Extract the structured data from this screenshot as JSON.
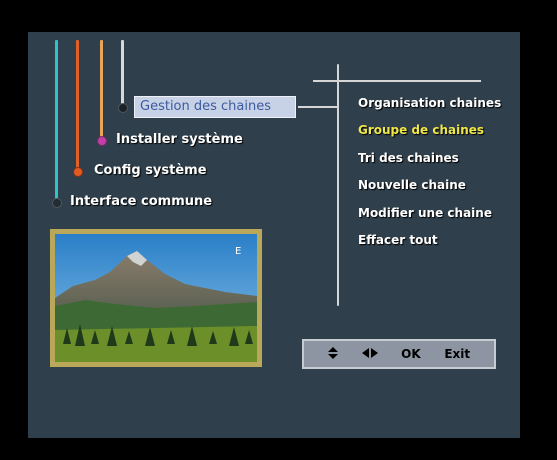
{
  "menu": {
    "items": [
      {
        "label": "Gestion des chaines",
        "selected": true,
        "bullet_color": "#1a2428"
      },
      {
        "label": "Installer système",
        "selected": false,
        "bullet_color": "#c23fa8"
      },
      {
        "label": "Config système",
        "selected": false,
        "bullet_color": "#e05a23"
      },
      {
        "label": "Interface commune",
        "selected": false,
        "bullet_color": "#1f2c34"
      }
    ]
  },
  "submenu": {
    "items": [
      {
        "label": "Organisation chaines",
        "active": false
      },
      {
        "label": "Groupe de chaines",
        "active": true
      },
      {
        "label": "Tri des chaines",
        "active": false
      },
      {
        "label": "Nouvelle chaine",
        "active": false
      },
      {
        "label": "Modifier une chaine",
        "active": false
      },
      {
        "label": "Effacer tout",
        "active": false
      }
    ]
  },
  "preview": {
    "icon": "mountain-landscape-image",
    "badge": "E"
  },
  "controls": {
    "updown_icon": "updown-arrows-icon",
    "leftright_icon": "leftright-arrows-icon",
    "ok_label": "OK",
    "exit_label": "Exit"
  },
  "colors": {
    "background": "#2f3f4b",
    "highlight": "#f0e64a",
    "line_cyan": "#2ec4c8",
    "line_orange": "#e0602a",
    "line_amber": "#e8a55a",
    "line_white": "#d8d8d8"
  }
}
